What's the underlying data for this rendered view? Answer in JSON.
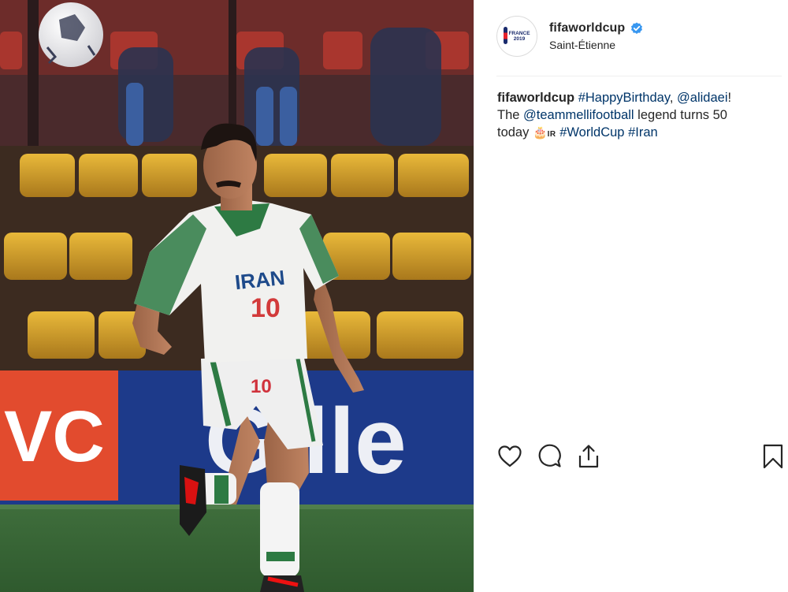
{
  "post": {
    "username": "fifaworldcup",
    "location": "Saint-Étienne",
    "avatar_logo_text": "FRANCE 2019",
    "caption": {
      "username": "fifaworldcup",
      "part1_tag": "#HappyBirthday",
      "part1_comma": ", ",
      "part1_mention": "@alidaei",
      "part1_end": "!",
      "part2_start": "The ",
      "part2_mention": "@teammellifootball",
      "part2_end": " legend turns 50",
      "part3_start": "today ",
      "part3_emoji": "🎂",
      "part3_flag": "IR",
      "part3_tag1": "#WorldCup",
      "part3_tag2": "#Iran"
    },
    "photo": {
      "jersey_text": "IRAN",
      "jersey_number": "10",
      "shorts_number": "10",
      "ad_left": "VC",
      "ad_right": "Gille"
    }
  },
  "icons": {
    "verified": "verified-badge-icon",
    "like": "heart-icon",
    "comment": "comment-icon",
    "share": "share-icon",
    "save": "bookmark-icon"
  },
  "colors": {
    "link": "#003569",
    "verified": "#3897f0",
    "text": "#262626"
  }
}
